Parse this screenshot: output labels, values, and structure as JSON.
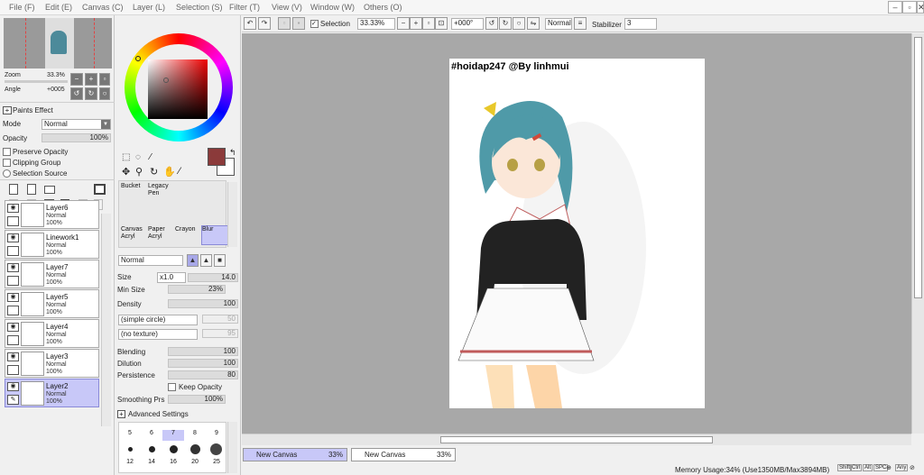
{
  "menu": [
    {
      "label": "File (F)"
    },
    {
      "label": "Edit (E)"
    },
    {
      "label": "Canvas (C)"
    },
    {
      "label": "Layer (L)"
    },
    {
      "label": "Selection (S)"
    },
    {
      "label": "Filter (T)"
    },
    {
      "label": "View (V)"
    },
    {
      "label": "Window (W)"
    },
    {
      "label": "Others (O)"
    }
  ],
  "window_controls": {
    "minimize": "–",
    "maximize": "▫",
    "close": "✕"
  },
  "navigator": {
    "zoom_label": "Zoom",
    "zoom_value": "33.3%",
    "angle_label": "Angle",
    "angle_value": "+0005"
  },
  "paints_effect": {
    "title": "Paints Effect",
    "mode_label": "Mode",
    "mode_value": "Normal",
    "opacity_label": "Opacity",
    "opacity_value": "100%",
    "preserve_opacity": "Preserve Opacity",
    "clipping_group": "Clipping Group",
    "selection_source": "Selection Source"
  },
  "layers": [
    {
      "name": "Layer6",
      "mode": "Normal",
      "opacity": "100%",
      "selected": false
    },
    {
      "name": "Linework1",
      "mode": "Normal",
      "opacity": "100%",
      "selected": false
    },
    {
      "name": "Layer7",
      "mode": "Normal",
      "opacity": "100%",
      "selected": false
    },
    {
      "name": "Layer5",
      "mode": "Normal",
      "opacity": "100%",
      "selected": false
    },
    {
      "name": "Layer4",
      "mode": "Normal",
      "opacity": "100%",
      "selected": false
    },
    {
      "name": "Layer3",
      "mode": "Normal",
      "opacity": "100%",
      "selected": false
    },
    {
      "name": "Layer2",
      "mode": "Normal",
      "opacity": "100%",
      "selected": true
    }
  ],
  "colors": {
    "primary": "#8b3a3a",
    "secondary": "#ffffff",
    "selection_highlight": "#c8c8f8",
    "canvas_bg": "#a8a8a8"
  },
  "tools": [
    {
      "label1": "Bucket",
      "label2": ""
    },
    {
      "label1": "Legacy",
      "label2": "Pen"
    },
    {
      "label1": "Canvas",
      "label2": "Acryl"
    },
    {
      "label1": "Paper",
      "label2": "Acryl"
    },
    {
      "label1": "Crayon",
      "label2": ""
    },
    {
      "label1": "Blur",
      "label2": ""
    }
  ],
  "brush": {
    "blend_mode": "Normal",
    "size_label": "Size",
    "size_mult": "x1.0",
    "size_value": "14.0",
    "min_size_label": "Min Size",
    "min_size_value": "23%",
    "density_label": "Density",
    "density_value": "100",
    "shape": "(simple circle)",
    "shape_value": "50",
    "texture": "(no texture)",
    "texture_value": "95",
    "blending_label": "Blending",
    "blending_value": "100",
    "dilution_label": "Dilution",
    "dilution_value": "100",
    "persistence_label": "Persistence",
    "persistence_value": "80",
    "keep_opacity": "Keep Opacity",
    "smoothing_label": "Smoothing Prs",
    "smoothing_value": "100%",
    "advanced": "Advanced Settings",
    "sizes_row1": [
      "5",
      "6",
      "7",
      "8",
      "9"
    ],
    "sizes_row2": [
      "12",
      "14",
      "16",
      "20",
      "25"
    ]
  },
  "toolbar": {
    "selection_label": "Selection",
    "zoom": "33.33%",
    "rotation": "+000°",
    "blend": "Normal",
    "stabilizer_label": "Stabilizer",
    "stabilizer_value": "3"
  },
  "canvas_text": "#hoidap247 @By linhmui",
  "tabs": [
    {
      "label": "New Canvas",
      "zoom": "33%"
    },
    {
      "label": "New Canvas",
      "zoom": "33%"
    }
  ],
  "status": {
    "memory": "Memory Usage:34% (Use1350MB/Max3894MB)",
    "keys": [
      "Shift",
      "Ctrl",
      "Alt",
      "SPC",
      "⊕",
      "Any",
      "⊘"
    ]
  }
}
